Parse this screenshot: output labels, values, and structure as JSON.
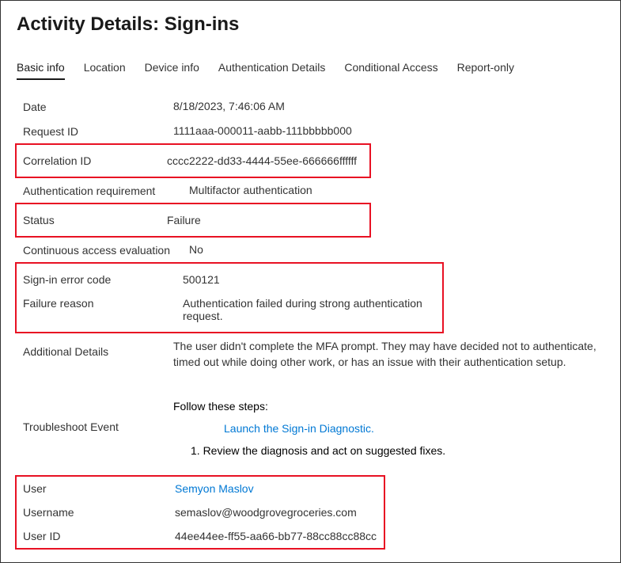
{
  "page_title": "Activity Details: Sign-ins",
  "tabs": {
    "basic_info": "Basic info",
    "location": "Location",
    "device_info": "Device info",
    "auth_details": "Authentication Details",
    "conditional_access": "Conditional Access",
    "report_only": "Report-only"
  },
  "rows": {
    "date": {
      "label": "Date",
      "value": "8/18/2023, 7:46:06 AM"
    },
    "request_id": {
      "label": "Request ID",
      "value": "1111aaa-000011-aabb-111bbbbb000"
    },
    "correlation_id": {
      "label": "Correlation ID",
      "value": "cccc2222-dd33-4444-55ee-666666ffffff"
    },
    "auth_req": {
      "label": "Authentication requirement",
      "value": "Multifactor authentication"
    },
    "status": {
      "label": "Status",
      "value": "Failure"
    },
    "cae": {
      "label": "Continuous access evaluation",
      "value": "No"
    },
    "error_code": {
      "label": "Sign-in error code",
      "value": "500121"
    },
    "failure_reason": {
      "label": "Failure reason",
      "value": "Authentication failed during strong authentication request."
    },
    "additional_details": {
      "label": "Additional Details",
      "value": "The user didn't complete the MFA prompt. They may have decided not to authenticate, timed out while doing other work, or has an issue with their authentication setup."
    },
    "troubleshoot": {
      "label": "Troubleshoot Event",
      "follow": "Follow these steps:",
      "launch": "Launch the Sign-in Diagnostic.",
      "step1": "1. Review the diagnosis and act on suggested fixes."
    },
    "user": {
      "label": "User",
      "value": "Semyon Maslov"
    },
    "username": {
      "label": "Username",
      "value": "semaslov@woodgrovegroceries.com"
    },
    "user_id": {
      "label": "User ID",
      "value": "44ee44ee-ff55-aa66-bb77-88cc88cc88cc"
    }
  }
}
